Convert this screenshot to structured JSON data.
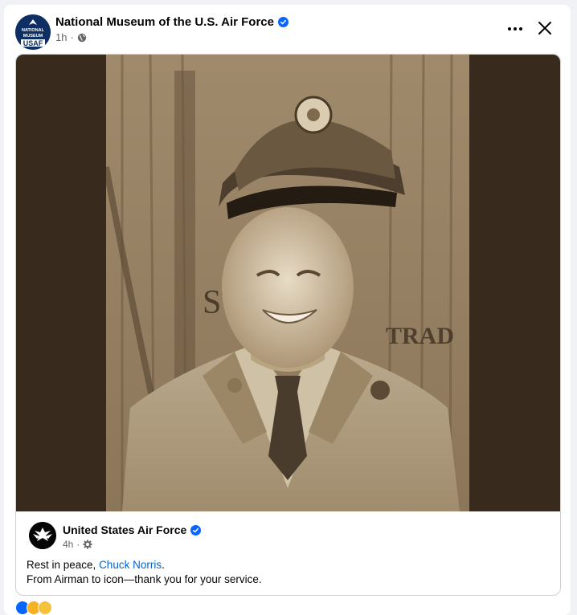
{
  "post": {
    "page_name": "National Museum of the U.S. Air Force",
    "avatar_lines": [
      "NATIONAL",
      "MUSEUM",
      "USAF"
    ],
    "time": "1h",
    "separator": "·",
    "audience_icon": "globe-icon",
    "menu_icon": "more-options-icon",
    "close_icon": "close-icon"
  },
  "shared": {
    "page_name": "United States Air Force",
    "time": "4h",
    "separator": "·",
    "audience_icon": "gear-icon",
    "text_prefix": "Rest in peace, ",
    "mention": "Chuck Norris",
    "text_suffix": ".",
    "text_line2": "From Airman to icon—thank you for your service."
  },
  "photo": {
    "sign_text_left": "STO",
    "sign_text_right": "TRAD"
  },
  "colors": {
    "verified": "#0866ff",
    "link": "#0064d1",
    "secondary_text": "#65676b",
    "photo_backdrop": "#382b1d"
  },
  "reactions": [
    "like",
    "haha",
    "care"
  ]
}
